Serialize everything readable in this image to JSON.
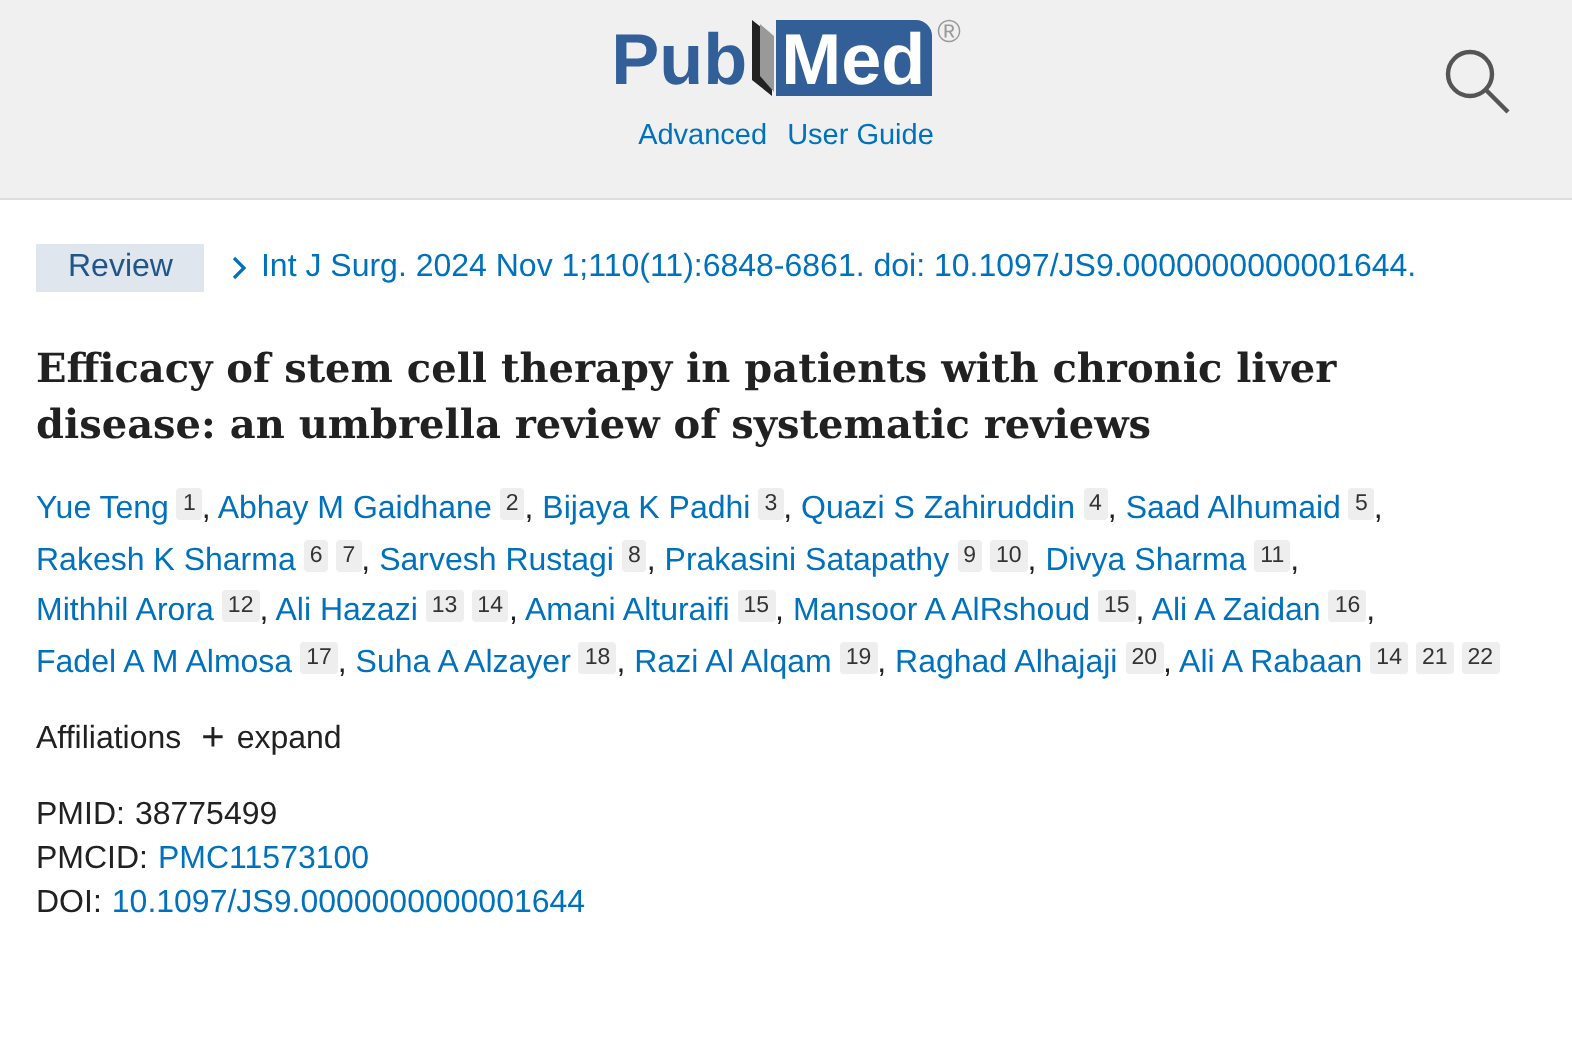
{
  "header": {
    "logo": {
      "left": "Pub",
      "right": "Med",
      "mark": "®"
    },
    "links": [
      "Advanced",
      "User Guide"
    ]
  },
  "article": {
    "type_badge": "Review",
    "citation": "Int J Surg. 2024 Nov 1;110(11):6848-6861. doi: 10.1097/JS9.0000000000001644.",
    "title": "Efficacy of stem cell therapy in patients with chronic liver disease: an umbrella review of systematic reviews",
    "authors": [
      {
        "name": "Yue Teng",
        "affiliations": [
          "1"
        ],
        "separator": ","
      },
      {
        "name": "Abhay M Gaidhane",
        "affiliations": [
          "2"
        ],
        "separator": ","
      },
      {
        "name": "Bijaya K Padhi",
        "affiliations": [
          "3"
        ],
        "separator": ","
      },
      {
        "name": "Quazi S Zahiruddin",
        "affiliations": [
          "4"
        ],
        "separator": ","
      },
      {
        "name": "Saad Alhumaid",
        "affiliations": [
          "5"
        ],
        "separator": ","
      },
      {
        "name": "Rakesh K Sharma",
        "affiliations": [
          "6",
          "7"
        ],
        "separator": ","
      },
      {
        "name": "Sarvesh Rustagi",
        "affiliations": [
          "8"
        ],
        "separator": ","
      },
      {
        "name": "Prakasini Satapathy",
        "affiliations": [
          "9",
          "10"
        ],
        "separator": ","
      },
      {
        "name": "Divya Sharma",
        "affiliations": [
          "11"
        ],
        "separator": ","
      },
      {
        "name": "Mithhil Arora",
        "affiliations": [
          "12"
        ],
        "separator": ","
      },
      {
        "name": "Ali Hazazi",
        "affiliations": [
          "13",
          "14"
        ],
        "separator": ","
      },
      {
        "name": "Amani Alturaifi",
        "affiliations": [
          "15"
        ],
        "separator": ","
      },
      {
        "name": "Mansoor A AlRshoud",
        "affiliations": [
          "15"
        ],
        "separator": ","
      },
      {
        "name": "Ali A Zaidan",
        "affiliations": [
          "16"
        ],
        "separator": ","
      },
      {
        "name": "Fadel A M Almosa",
        "affiliations": [
          "17"
        ],
        "separator": ","
      },
      {
        "name": "Suha A Alzayer",
        "affiliations": [
          "18"
        ],
        "separator": ","
      },
      {
        "name": "Razi Al Alqam",
        "affiliations": [
          "19"
        ],
        "separator": ","
      },
      {
        "name": "Raghad Alhajaji",
        "affiliations": [
          "20"
        ],
        "separator": ","
      },
      {
        "name": "Ali A Rabaan",
        "affiliations": [
          "14",
          "21",
          "22"
        ]
      }
    ],
    "affiliations": {
      "label": "Affiliations",
      "toggle_icon": "+",
      "toggle": "expand"
    },
    "identifiers": [
      {
        "label": "PMID:",
        "value": "38775499",
        "kind": "text"
      },
      {
        "label": "PMCID:",
        "value": "PMC11573100",
        "kind": "link"
      },
      {
        "label": "DOI:",
        "value": "10.1097/JS9.0000000000001644",
        "kind": "link"
      }
    ]
  }
}
